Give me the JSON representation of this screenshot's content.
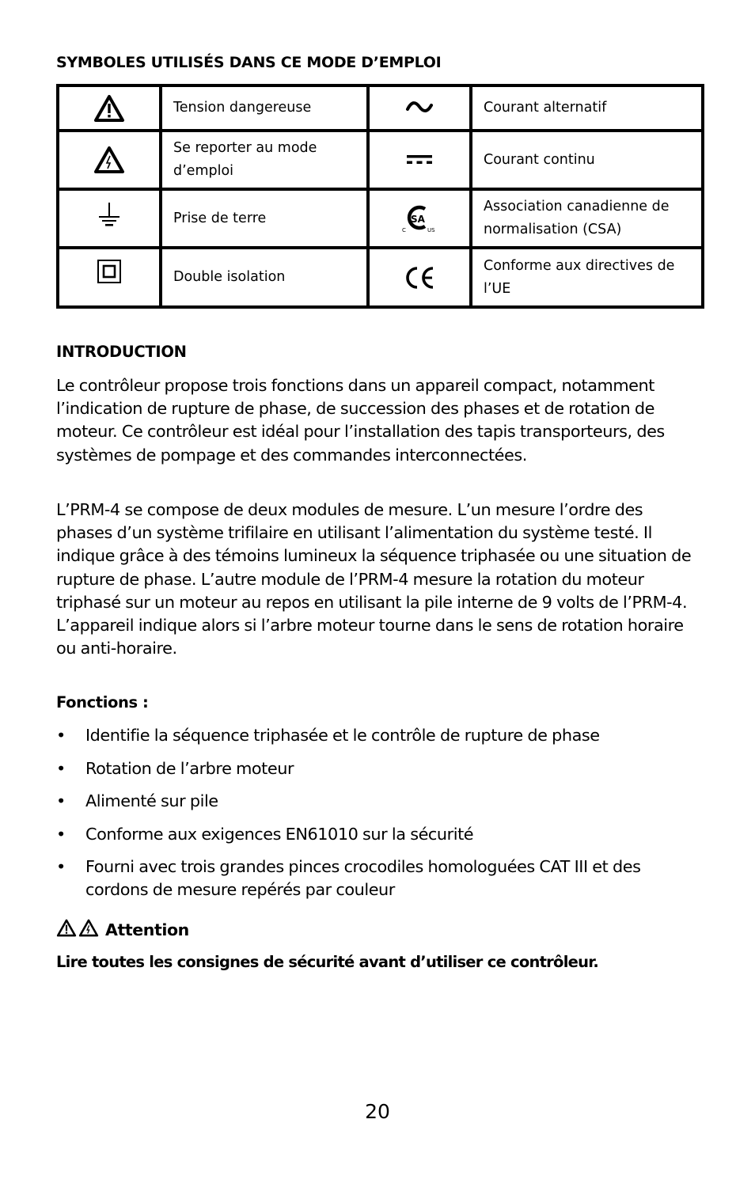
{
  "symbols_section": {
    "title": "SYMBOLES UTILISÉS DANS CE MODE D’EMPLOI",
    "rows": [
      {
        "left": {
          "icon": "warning-exclamation-icon",
          "label": "Tension dangereuse"
        },
        "right": {
          "icon": "alternating-current-icon",
          "label": "Courant alternatif"
        }
      },
      {
        "left": {
          "icon": "warning-lightning-icon",
          "label": "Se reporter au mode d’emploi"
        },
        "right": {
          "icon": "direct-current-icon",
          "label": "Courant continu"
        }
      },
      {
        "left": {
          "icon": "ground-icon",
          "label": "Prise de terre"
        },
        "right": {
          "icon": "csa-logo-icon",
          "label": "Association canadienne de normalisation (CSA)",
          "icon_text": {
            "csa": "SA",
            "left": "C",
            "right": "US"
          }
        }
      },
      {
        "left": {
          "icon": "double-insulation-icon",
          "label": "Double isolation"
        },
        "right": {
          "icon": "ce-mark-icon",
          "label": "Conforme aux directives de l’UE",
          "icon_text": "CE"
        }
      }
    ]
  },
  "introduction": {
    "title": "INTRODUCTION",
    "paragraphs": [
      "Le contrôleur propose trois fonctions dans un appareil compact, notamment l’indication de rupture de phase, de succession des phases et de rotation de moteur. Ce contrôleur est idéal pour l’installation des tapis transporteurs, des systèmes de pompage et des commandes interconnectées.",
      "L’PRM-4 se compose de deux modules de mesure. L’un mesure l’ordre des phases d’un système trifilaire en utilisant l’alimentation du système testé. Il indique grâce à des témoins lumineux la séquence triphasée ou une situation de rupture de phase. L’autre module de l’PRM-4 mesure la rotation du moteur triphasé sur un moteur au repos en utilisant la pile interne de 9 volts de l’PRM-4. L’appareil indique alors si l’arbre moteur tourne dans le sens de rotation horaire ou anti-horaire."
    ]
  },
  "functions": {
    "title": "Fonctions :",
    "bullet": "•",
    "items": [
      "Identifie la séquence triphasée et le contrôle de rupture de phase",
      "Rotation de l’arbre moteur",
      "Alimenté sur pile",
      "Conforme aux exigences EN61010 sur la sécurité",
      "Fourni avec trois grandes pinces crocodiles homologuées CAT III et des cordons de mesure repérés par couleur"
    ]
  },
  "attention": {
    "icons": [
      "warning-exclamation-icon",
      "warning-lightning-icon"
    ],
    "label": "Attention",
    "text": "Lire toutes les consignes de sécurité avant d’utiliser ce contrôleur."
  },
  "page_number": "20"
}
